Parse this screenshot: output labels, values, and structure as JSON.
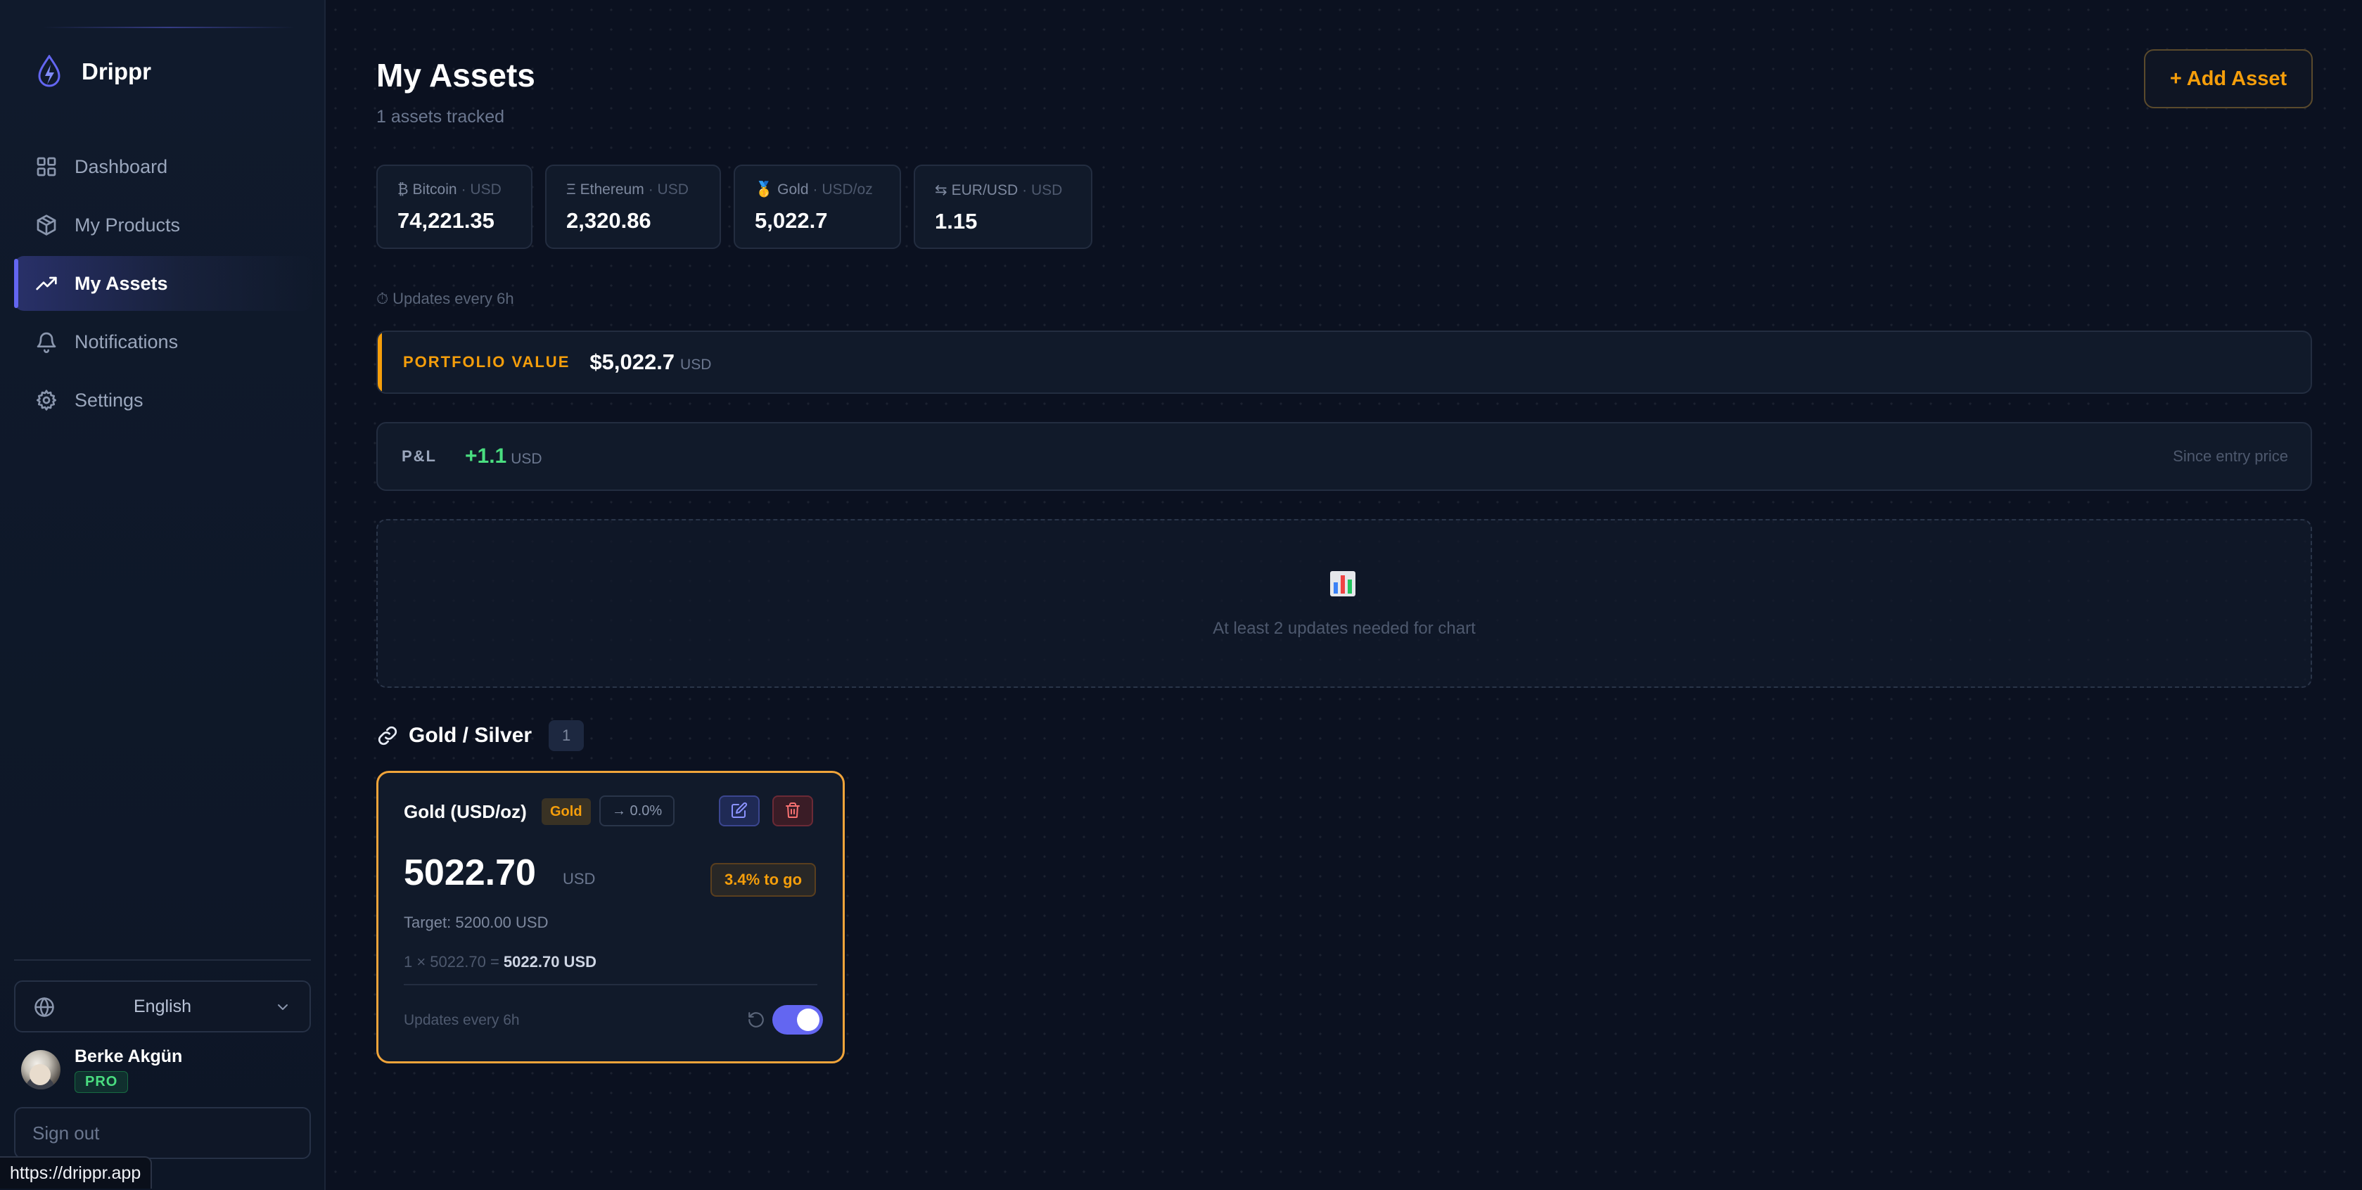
{
  "app": {
    "name": "Drippr"
  },
  "sidebar": {
    "items": [
      {
        "label": "Dashboard",
        "icon": "grid-icon",
        "active": false
      },
      {
        "label": "My Products",
        "icon": "box-icon",
        "active": false
      },
      {
        "label": "My Assets",
        "icon": "trending-up-icon",
        "active": true
      },
      {
        "label": "Notifications",
        "icon": "bell-icon",
        "active": false
      },
      {
        "label": "Settings",
        "icon": "gear-icon",
        "active": false
      }
    ],
    "language": "English",
    "user": {
      "name": "Berke Akgün",
      "plan": "PRO"
    },
    "signout_label": "Sign out"
  },
  "status_url": "https://drippr.app",
  "header": {
    "title": "My Assets",
    "subtitle": "1 assets tracked",
    "add_label": "+ Add Asset"
  },
  "tickers": [
    {
      "symbol": "₿",
      "name": "Bitcoin",
      "unit": "· USD",
      "value": "74,221.35"
    },
    {
      "symbol": "Ξ",
      "name": "Ethereum",
      "unit": "· USD",
      "value": "2,320.86"
    },
    {
      "symbol": "🥇",
      "name": "Gold",
      "unit": "· USD/oz",
      "value": "5,022.7"
    },
    {
      "symbol": "⇆",
      "name": "EUR/USD",
      "unit": "· USD",
      "value": "1.15"
    }
  ],
  "updates_note": {
    "icon": "⏱",
    "text": "Updates every 6h"
  },
  "portfolio": {
    "label": "PORTFOLIO VALUE",
    "value": "$5,022.7",
    "unit": "USD"
  },
  "pl": {
    "label": "P&L",
    "value": "+1.1",
    "unit": "USD",
    "since": "Since entry price"
  },
  "chart_placeholder": {
    "icon": "📊",
    "message": "At least 2 updates needed for chart"
  },
  "group": {
    "title": "Gold / Silver",
    "count": "1",
    "assets": [
      {
        "name": "Gold (USD/oz)",
        "tag": "Gold",
        "trend": "→ 0.0%",
        "price": "5022.70",
        "price_unit": "USD",
        "to_go": "3.4% to go",
        "target": "Target: 5200.00 USD",
        "calc_prefix": "1 × 5022.70 =",
        "calc_total": "5022.70 USD",
        "updates": "Updates every 6h",
        "enabled": true
      }
    ]
  },
  "colors": {
    "accent": "#6366f1",
    "warning": "#f59e0b",
    "positive": "#4ade80",
    "danger": "#f87171",
    "background": "#0b1120"
  }
}
